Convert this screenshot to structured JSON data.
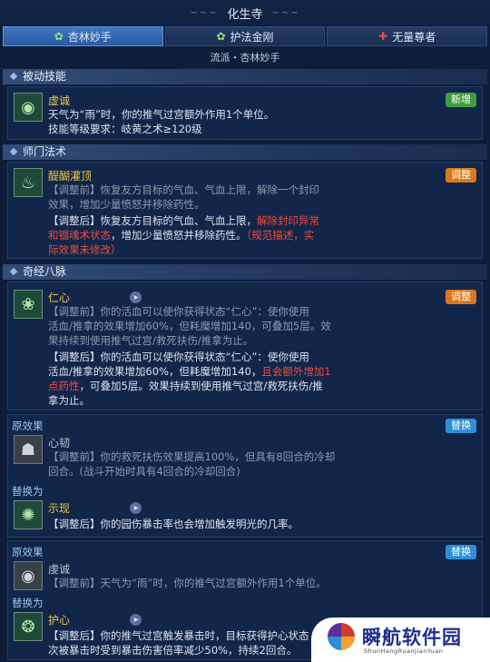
{
  "header": {
    "title": "化生寺",
    "left_ornament": "~~~",
    "right_ornament": "~~~"
  },
  "tabs": [
    {
      "label": "杏林妙手",
      "icon": "leaf-icon",
      "active": true
    },
    {
      "label": "护法金刚",
      "icon": "leaf-icon",
      "active": false
    },
    {
      "label": "无量尊者",
      "icon": "cross-icon",
      "active": false
    }
  ],
  "sub_header": "流派・杏林妙手",
  "sections": {
    "passive": "被动技能",
    "school": "师门法术",
    "meridian": "奇经八脉"
  },
  "passive_skill": {
    "name": "虚诚",
    "badge": "新增",
    "desc1": "天气为“雨”时，你的推气过宫额外作用1个单位。",
    "desc2": "技能等级要求：岐黄之术≥120级"
  },
  "school_skill": {
    "name": "醍醐灌顶",
    "badge": "调整",
    "before_1": "【调整前】恢复友方目标的气血、气血上限，解除一个封印",
    "before_2": "效果，增加少量愤怒并移除药性。",
    "after_1a": "【调整后】恢复友方目标的气血、气血上限，",
    "after_1b": "解除封印异常",
    "after_2a": "和锢魂术状态",
    "after_2b": "，增加少量愤怒并移除药性。",
    "after_2c": "（规范描述，实",
    "after_3": "际效果未修改）"
  },
  "meridian_skill": {
    "name": "仁心",
    "badge": "调整",
    "before_1": "【调整前】你的活血可以使你获得状态“仁心”：使你使用",
    "before_2": "活血/推拿的效果增加60%，但耗魔增加140，可叠加5层。效",
    "before_3": "果持续到使用推气过宫/救死扶伤/推拿为止。",
    "after_1": "【调整后】你的活血可以使你获得状态“仁心”：使你使用",
    "after_2a": "活血/推拿的效果增加60%，但耗魔增加140，",
    "after_2b": "且会额外增加1",
    "after_3a": "点药性",
    "after_3b": "，可叠加5层。效果持续到使用推气过宫/救死扶伤/推",
    "after_4": "拿为止。"
  },
  "replace_1": {
    "orig_label": "原效果",
    "badge": "替换",
    "orig_name": "心韧",
    "orig_1": "【调整前】你的救死扶伤效果提高100%，但具有8回合的冷却",
    "orig_2": "回合。(战斗开始时具有4回合的冷却回合)",
    "new_label": "替换为",
    "new_name": "示现",
    "new_1": "【调整后】你的园伤暴击率也会增加触发明光的几率。"
  },
  "replace_2": {
    "orig_label": "原效果",
    "badge": "替换",
    "orig_name": "虔诚",
    "orig_1": "【调整前】天气为“雨”时，你的推气过宫额外作用1个单位。",
    "new_label": "替换为",
    "new_name": "护心",
    "new_1": "【调整后】你的推气过宫触发暴击时，目标获得护心状态",
    "new_2": "次被暴击时受到暴击伤害倍率减少50%，持续2回合。"
  },
  "watermark": {
    "main": "瞬航软件园",
    "sub": "ShunHangRuanJianYuan"
  }
}
